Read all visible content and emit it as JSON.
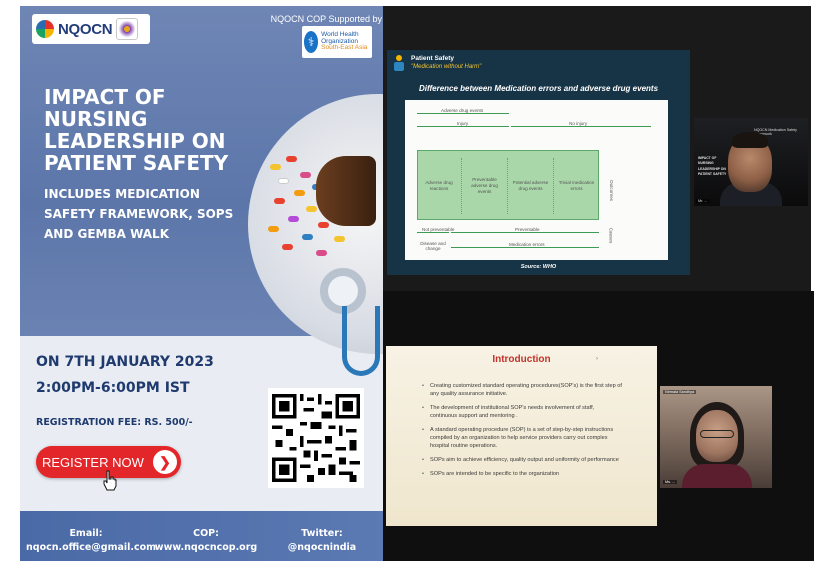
{
  "poster": {
    "logo_text": "NQOCN",
    "supported_by": "NQOCN COP Supported by",
    "who_name": "World Health Organization",
    "who_region": "South-East Asia",
    "title": "IMPACT OF NURSING LEADERSHIP ON PATIENT SAFETY",
    "subtitle": "INCLUDES MEDICATION SAFETY FRAMEWORK, SOPS AND GEMBA WALK",
    "date": "ON 7TH JANUARY 2023",
    "time": "2:00PM-6:00PM IST",
    "fee": "REGISTRATION FEE: RS. 500/-",
    "register_label": "REGISTER NOW",
    "footer": {
      "email_label": "Email:",
      "email_value": "nqocn.office@gmail.com",
      "cop_label": "COP:",
      "cop_value": "www.nqocncop.org",
      "twitter_label": "Twitter:",
      "twitter_value": "@nqocnindia"
    }
  },
  "slide_top": {
    "brand": "Patient Safety",
    "tagline": "\"Medication without Harm\"",
    "heading": "Difference between Medication errors and adverse drug events",
    "labels": {
      "ade": "Adverse drug events",
      "injury": "Injury",
      "no_injury": "No injury",
      "outcomes": "Outcomes",
      "causes": "Causes",
      "not_preventable": "Not preventable",
      "preventable": "Preventable",
      "medication_errors": "Medication errors",
      "disease_change": "Disease and change"
    },
    "boxes": [
      "Adverse drug reactions",
      "Preventable adverse drug events",
      "Potential adverse drug events",
      "Trivial medication errors"
    ],
    "source": "Source: WHO"
  },
  "cam_top": {
    "header": "NQOCN Medication Safety Framework",
    "slide_text": [
      "IMPACT OF",
      "NURSING",
      "LEADERSHIP ON",
      "PATIENT SAFETY"
    ],
    "name": "Mr. ..."
  },
  "slide_bottom": {
    "title": "Introduction",
    "items": [
      "Creating customized standard operating procedures(SOP's) is the first step of any quality assurance initiative.",
      "The development of institutional SOP's needs involvement of staff, continuous support and mentoring .",
      "A standard operating procedure (SOP) is a set of step-by-step instructions compiled by an organization to help service providers carry out complex hospital routine operations.",
      "SOPs aim to achieve efficiency, quality output and uniformity of performance",
      "SOPs are intended to be specific to the organization"
    ]
  },
  "cam_bot": {
    "label": "Nirmala Sandhya",
    "name": "Ms. ..."
  }
}
